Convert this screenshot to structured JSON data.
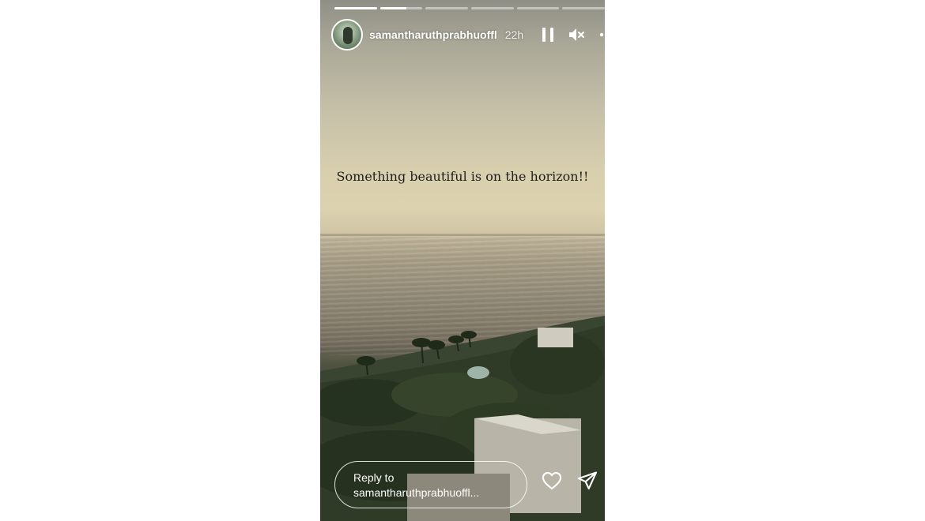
{
  "story": {
    "progress": {
      "segments": [
        1.0,
        0.62,
        0,
        0,
        0,
        0
      ]
    },
    "header": {
      "username": "samantharuthprabhuoffl",
      "time": "22h",
      "pause_icon": "pause-icon",
      "mute_icon": "speaker-muted-icon",
      "more_icon": "more-icon"
    },
    "caption": "Something beautiful is on the horizon!!",
    "reply": {
      "line1": "Reply to",
      "line2": "samantharuthprabhuoffl..."
    },
    "actions": {
      "like_icon": "heart-icon",
      "share_icon": "send-icon"
    },
    "colors": {
      "page_background": "#ffffff",
      "overlay_text": "#ffffff",
      "caption_text": "#1f1f1f"
    }
  }
}
